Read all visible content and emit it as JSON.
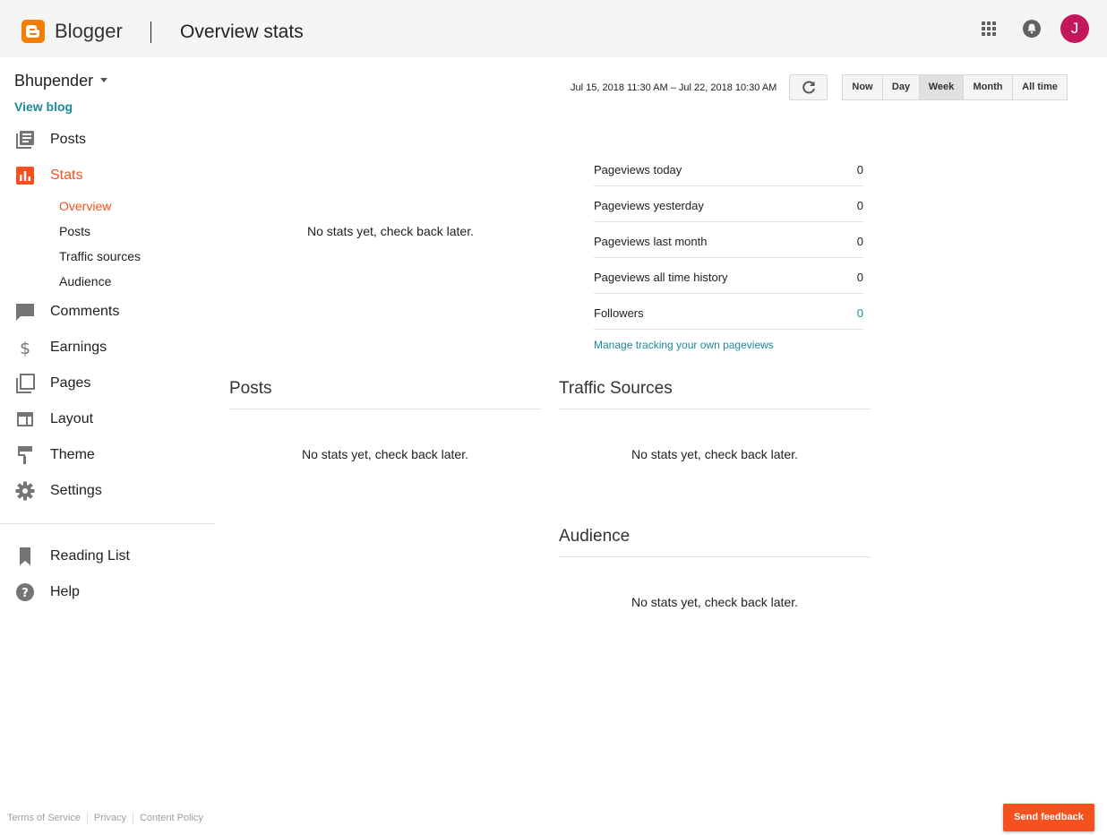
{
  "header": {
    "brand": "Blogger",
    "title": "Overview stats",
    "avatar_letter": "J",
    "brand_color": "#f57d00",
    "avatar_color": "#c2185b"
  },
  "sidebar": {
    "blog_name": "Bhupender",
    "view_blog": "View blog",
    "items": [
      {
        "label": "Posts",
        "icon": "posts-icon"
      },
      {
        "label": "Stats",
        "icon": "stats-icon",
        "active": true
      },
      {
        "label": "Comments",
        "icon": "comment-icon"
      },
      {
        "label": "Earnings",
        "icon": "dollar-icon"
      },
      {
        "label": "Pages",
        "icon": "pages-icon"
      },
      {
        "label": "Layout",
        "icon": "layout-icon"
      },
      {
        "label": "Theme",
        "icon": "paint-roller-icon"
      },
      {
        "label": "Settings",
        "icon": "gear-icon"
      }
    ],
    "stats_subitems": [
      {
        "label": "Overview",
        "active": true
      },
      {
        "label": "Posts"
      },
      {
        "label": "Traffic sources"
      },
      {
        "label": "Audience"
      }
    ],
    "bottom_items": [
      {
        "label": "Reading List",
        "icon": "bookmark-icon"
      },
      {
        "label": "Help",
        "icon": "help-icon"
      }
    ],
    "accent_color": "#f4511e"
  },
  "toolbar": {
    "date_range": "Jul 15, 2018 11:30 AM – Jul 22, 2018 10:30 AM",
    "ranges": [
      "Now",
      "Day",
      "Week",
      "Month",
      "All time"
    ],
    "selected_range": "Week"
  },
  "overview": {
    "no_stats": "No stats yet, check back later.",
    "stats": [
      {
        "label": "Pageviews today",
        "value": "0"
      },
      {
        "label": "Pageviews yesterday",
        "value": "0"
      },
      {
        "label": "Pageviews last month",
        "value": "0"
      },
      {
        "label": "Pageviews all time history",
        "value": "0"
      },
      {
        "label": "Followers",
        "value": "0"
      }
    ],
    "manage_link": "Manage tracking your own pageviews"
  },
  "sections": {
    "posts": {
      "title": "Posts",
      "message": "No stats yet, check back later."
    },
    "traffic": {
      "title": "Traffic Sources",
      "message": "No stats yet, check back later."
    },
    "audience": {
      "title": "Audience",
      "message": "No stats yet, check back later."
    }
  },
  "footer": {
    "links": [
      "Terms of Service",
      "Privacy",
      "Content Policy"
    ],
    "feedback": "Send feedback"
  }
}
